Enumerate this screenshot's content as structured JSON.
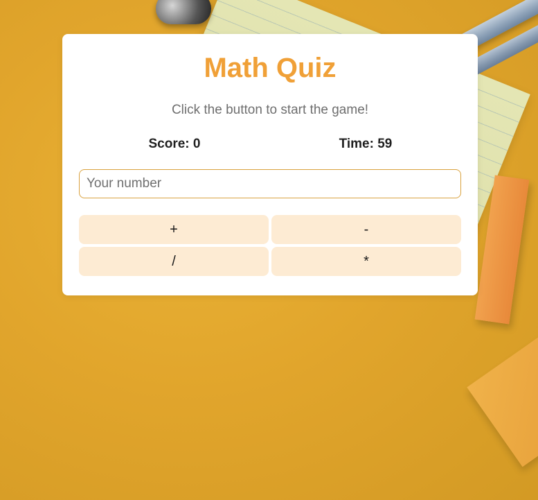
{
  "quiz": {
    "title": "Math Quiz",
    "message": "Click the button to start the game!",
    "score_text": "Score: 0",
    "time_text": "Time: 59",
    "input": {
      "placeholder": "Your number",
      "value": ""
    },
    "operators": [
      {
        "label": "+"
      },
      {
        "label": "-"
      },
      {
        "label": "/"
      },
      {
        "label": "*"
      }
    ]
  },
  "colors": {
    "title": "#f0a037",
    "button_bg": "#fdebd3",
    "input_border": "#d9a13d",
    "background": "#e1a52c"
  }
}
